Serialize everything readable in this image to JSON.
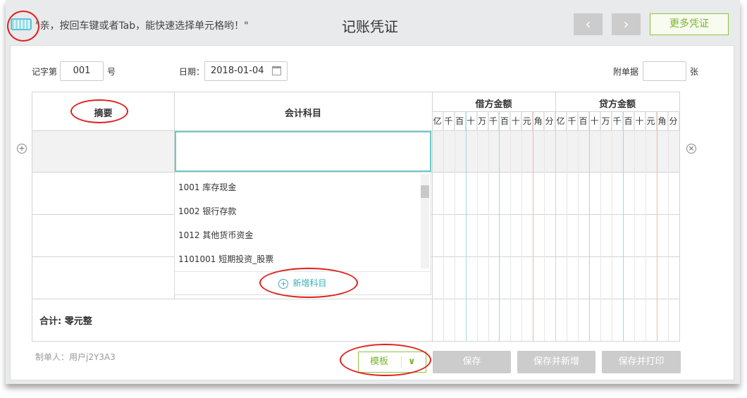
{
  "header": {
    "tip": "\"亲，按回车键或者Tab，能快速选择单元格哟！\"",
    "title": "记账凭证",
    "prev": "‹",
    "next": "›",
    "more": "更多凭证"
  },
  "form": {
    "voucher_prefix": "记字第",
    "voucher_no": "001",
    "voucher_suffix": "号",
    "date_label": "日期：",
    "date": "2018-01-04",
    "attach_label": "附单据",
    "attach_value": "",
    "attach_unit": "张"
  },
  "table": {
    "summary": "摘要",
    "account": "会计科目",
    "debit": "借方金额",
    "credit": "贷方金额",
    "digits": [
      "亿",
      "千",
      "百",
      "十",
      "万",
      "千",
      "百",
      "十",
      "元",
      "角",
      "分"
    ],
    "total_label": "合计:",
    "total_value": "零元整"
  },
  "dropdown": {
    "items": [
      "1001 库存现金",
      "1002 银行存款",
      "1012 其他货币资金",
      "1101001 短期投资_股票"
    ],
    "add": "新增科目"
  },
  "footer": {
    "maker": "制单人：用户j2Y3A3",
    "template": "模板",
    "save": "保存",
    "save_new": "保存并新增",
    "save_print": "保存并打印"
  }
}
